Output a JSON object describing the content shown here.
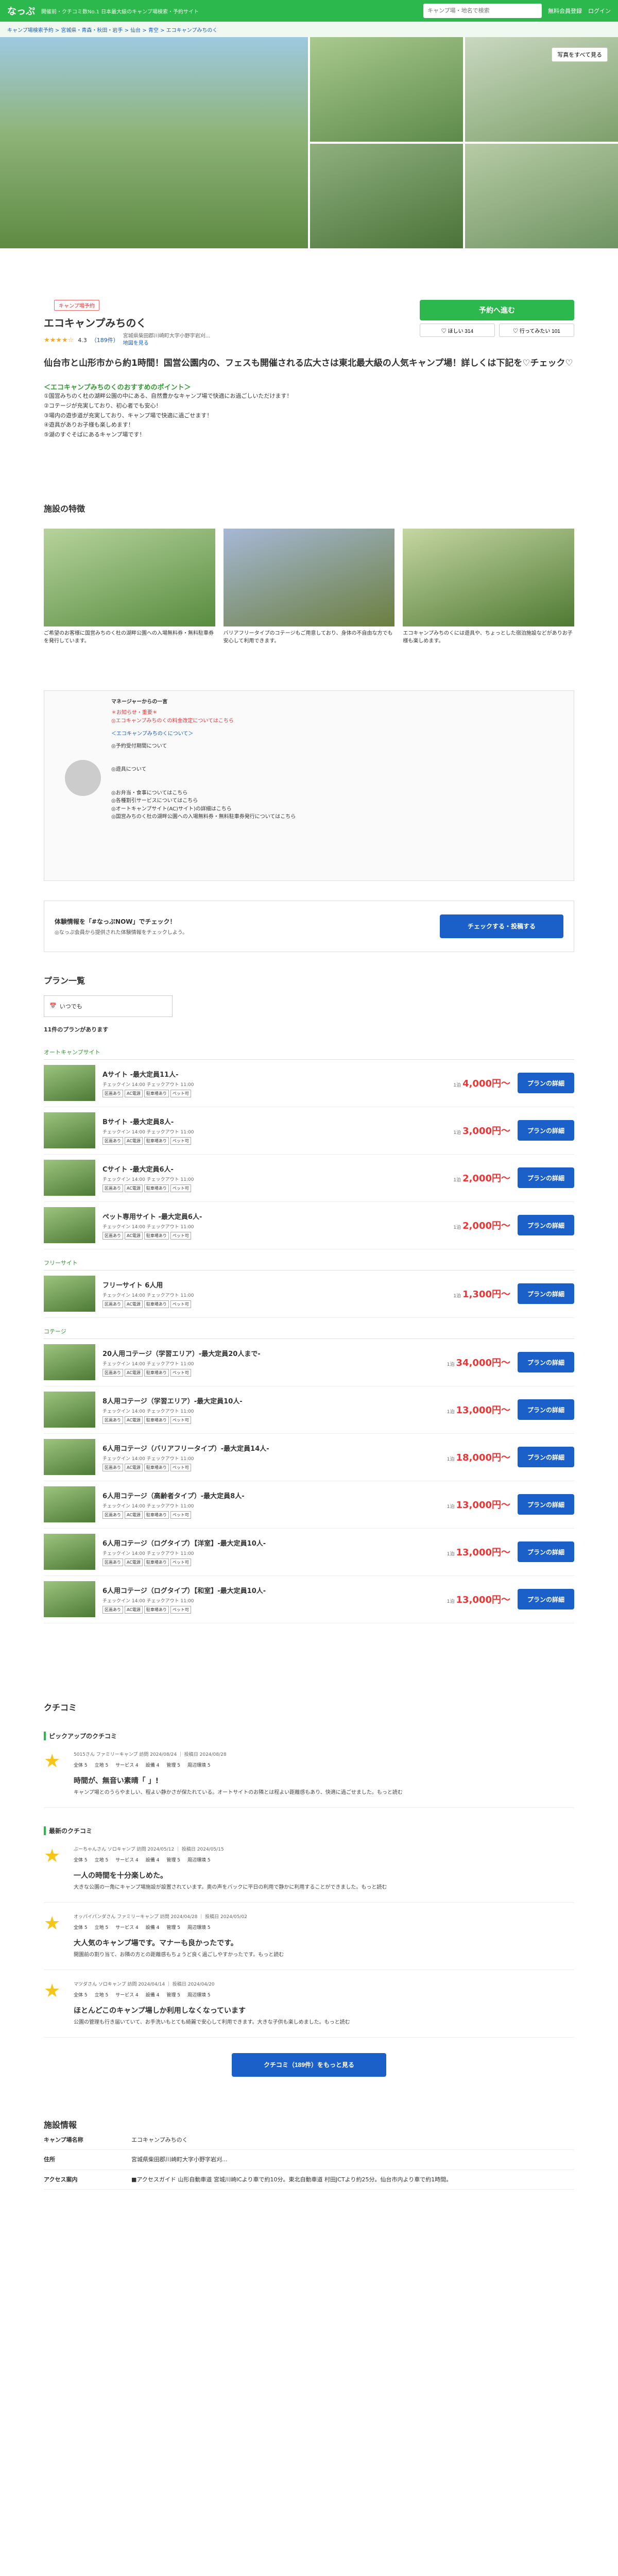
{
  "header": {
    "logo": "なっぷ",
    "tagline": "開催前・クチコミ数No.1 日本最大級のキャンプ場検索・予約サイト",
    "search_placeholder": "キャンプ場・地名で検索",
    "links": [
      "無料会員登録",
      "ログイン"
    ]
  },
  "breadcrumb": "キャンプ場検索予約 > 宮城県・青森・秋田・岩手 > 仙台 > 青空 > エコキャンプみちのく",
  "gallery": {
    "photo_button": "写真をすべて見る"
  },
  "campsite": {
    "badge": "キャンプ場予約",
    "name": "エコキャンプみちのく",
    "stars": "★★★★☆",
    "rating": "4.3",
    "review_count": "（189件）",
    "address": "宮城県柴田郡川崎町大字小野字岩刈...",
    "map_link": "地図を見る"
  },
  "actions": {
    "reserve": "予約へ進む",
    "like": "♡ ほしい 314",
    "share": "♡ 行ってみたい 101"
  },
  "lead": "仙台市と山形市から約1時間！国営公園内の、フェスも開催される広大さは東北最大級の人気キャンプ場！詳しくは下記を♡チェック♡",
  "desc": {
    "h1": "＜エコキャンプみちのくのおすすめのポイント＞",
    "p1": "①国営みちのく杜の湖畔公園の中にある、自然豊かなキャンプ場で快適にお過ごしいただけます！",
    "p2": "②コテージが充実しており、初心者でも安心！",
    "p3": "③場内の遊歩道が充実しており、キャンプ場で快適に過ごせます！",
    "p4": "④遊具がありお子様も楽しめます！",
    "p5": "⑤湖のすぐそばにあるキャンプ場です！"
  },
  "features": {
    "title": "施設の特徴",
    "items": [
      "ご希望のお客様に国営みちのく杜の湖畔公園への入場無料券・無料駐車券を発行しています。",
      "バリアフリータイプのコテージもご用意しており、身体の不自由な方でも安心して利用できます。",
      "エコキャンプみちのくには遊具や、ちょっとした宿泊施設などがありお子様も楽しめます。"
    ]
  },
  "manager": {
    "title": "マネージャーからの一言",
    "red1": "＊お知らせ・重要＊",
    "red2": "◎エコキャンプみちのくの料金改定についてはこちら",
    "sub": "＜エコキャンプみちのくについて＞",
    "lines": [
      "◎予約受付期間について",
      "◎遊具について",
      "◎お弁当・食事についてはこちら",
      "◎各種割引サービスについてはこちら",
      "◎オートキャンプサイト(AC)サイト)の詳細はこちら",
      "◎国営みちのく杜の湖畔公園への入場無料券・無料駐車券発行についてはこちら"
    ]
  },
  "notice": {
    "title": "体験情報を「#なっぷNOW」でチェック！",
    "desc": "◎なっぷ会員から提供された体験情報をチェックしよう。",
    "button": "チェックする・投稿する"
  },
  "plans": {
    "title": "プラン一覧",
    "filter": "いつでも",
    "count": "11件のプランがあります",
    "cat1": "オートキャンプサイト",
    "cat2": "フリーサイト",
    "cat3": "コテージ",
    "price_prefix": "1泊",
    "button": "プランの詳細",
    "detail": "チェックイン 14:00  チェックアウト 11:00",
    "tags": [
      "区画あり",
      "AC電源",
      "駐車場あり",
      "ペット可"
    ],
    "items": [
      {
        "name": "Aサイト -最大定員11人-",
        "price": "4,000円～"
      },
      {
        "name": "Bサイト -最大定員8人-",
        "price": "3,000円～"
      },
      {
        "name": "Cサイト -最大定員6人-",
        "price": "2,000円～"
      },
      {
        "name": "ペット専用サイト -最大定員6人-",
        "price": "2,000円～"
      },
      {
        "name": "フリーサイト 6人用",
        "price": "1,300円～"
      },
      {
        "name": "20人用コテージ（学習エリア）-最大定員20人まで-",
        "price": "34,000円～"
      },
      {
        "name": "8人用コテージ（学習エリア）-最大定員10人-",
        "price": "13,000円～"
      },
      {
        "name": "6人用コテージ（バリアフリータイプ）-最大定員14人-",
        "price": "18,000円～"
      },
      {
        "name": "6人用コテージ（高齢者タイプ）-最大定員8人-",
        "price": "13,000円～"
      },
      {
        "name": "6人用コテージ（ログタイプ）【洋室】-最大定員10人-",
        "price": "13,000円～"
      },
      {
        "name": "6人用コテージ（ログタイプ）【和室】-最大定員10人-",
        "price": "13,000円～"
      }
    ]
  },
  "reviews": {
    "title": "クチコミ",
    "pickup": "ピックアップのクチコミ",
    "latest": "最新のクチコミ",
    "scores": [
      "全体 5",
      "立地 5",
      "サービス 4",
      "設備 4",
      "管理 5",
      "周辺環境 5"
    ],
    "items": [
      {
        "meta": "5015さん ファミリーキャンプ 訪問 2024/08/24 ｜ 投稿日 2024/08/28",
        "head": "時間が、無音い素晴「 」!",
        "text": "キャンプ場とのうらやましい、程よい静かさが保たれている。オートサイトのお隣とは程よい距離感もあり、快適に過ごせました。もっと読む"
      },
      {
        "meta": "ぶーちゃんさん ソロキャンプ 訪問 2024/05/12 ｜ 投稿日 2024/05/15",
        "head": "一人の時間を十分楽しめた。",
        "text": "大きな公園の一角にキャンプ場施設が設置されています。奥の声をバックに平日の利用で静かに利用することができました。もっと読む"
      },
      {
        "meta": "オッパイパンダさん ファミリーキャンプ 訪問 2024/04/28 ｜ 投稿日 2024/05/02",
        "head": "大人気のキャンプ場です。マナーも良かったです。",
        "text": "開園前の割り当て、お隣の方との距離感もちょうど良く過ごしやすかったです。もっと読む"
      },
      {
        "meta": "マツダさん ソロキャンプ 訪問 2024/04/14 ｜ 投稿日 2024/04/20",
        "head": "ほとんどこのキャンプ場しか利用しなくなっています",
        "text": "公園の管理も行き届いていて、お手洗いもとても綺麗で安心して利用できます。大きな子供も楽しめました。もっと読む"
      }
    ],
    "more": "クチコミ（189件）をもっと見る"
  },
  "facility": {
    "title": "施設情報",
    "rows": [
      {
        "label": "キャンプ場名称",
        "value": "エコキャンプみちのく"
      },
      {
        "label": "住所",
        "value": "宮城県柴田郡川崎町大字小野字岩刈..."
      },
      {
        "label": "アクセス案内",
        "value": "■アクセスガイド 山形自動車道 宮城川崎ICより車で約10分。東北自動車道 村田JCTより約25分。仙台市内より車で約1時間。"
      }
    ]
  }
}
